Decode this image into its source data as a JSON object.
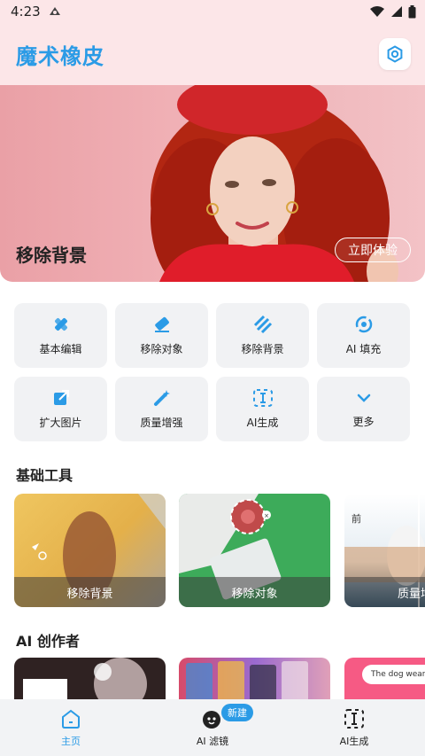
{
  "status_bar": {
    "time": "4:23"
  },
  "app": {
    "title": "魔术橡皮"
  },
  "hero": {
    "title": "移除背景",
    "cta_label": "立即体验"
  },
  "tools": [
    {
      "label": "基本编辑",
      "icon": "basic-edit-icon"
    },
    {
      "label": "移除对象",
      "icon": "eraser-icon"
    },
    {
      "label": "移除背景",
      "icon": "stripes-icon"
    },
    {
      "label": "AI 填充",
      "icon": "ai-fill-icon"
    },
    {
      "label": "扩大图片",
      "icon": "expand-image-icon"
    },
    {
      "label": "质量增强",
      "icon": "magic-wand-icon"
    },
    {
      "label": "AI生成",
      "icon": "text-cursor-icon"
    },
    {
      "label": "更多",
      "icon": "chevron-down-icon"
    }
  ],
  "basic_tools": {
    "title": "基础工具",
    "cards": [
      {
        "label": "移除背景"
      },
      {
        "label": "移除对象"
      },
      {
        "label": "质量增强",
        "badge": "前"
      }
    ]
  },
  "ai_creator": {
    "title": "AI 创作者",
    "third_card_text": "The dog wears"
  },
  "bottom_nav": {
    "items": [
      {
        "label": "主页",
        "icon": "home-icon",
        "active": true
      },
      {
        "label": "AI 滤镜",
        "icon": "ai-filter-icon",
        "active": false
      },
      {
        "label": "AI生成",
        "icon": "ai-generate-icon",
        "active": false
      }
    ],
    "new_badge": "新建"
  },
  "colors": {
    "accent": "#2b9be6",
    "header_bg": "#fce6e8",
    "tile_bg": "#f1f2f4"
  }
}
